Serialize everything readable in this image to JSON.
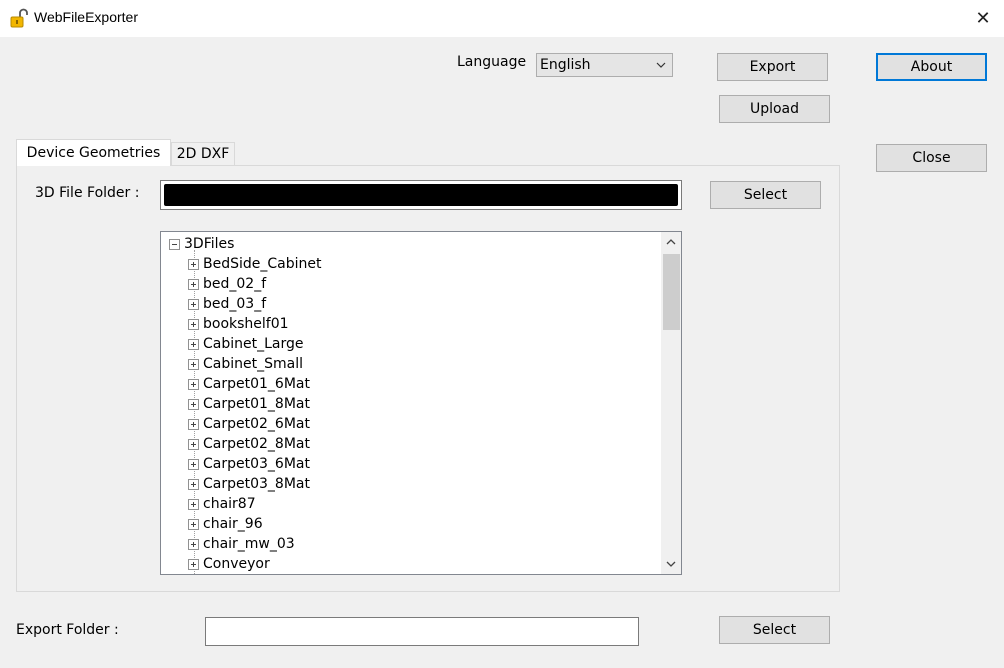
{
  "window": {
    "title": "WebFileExporter",
    "close_glyph": "✕",
    "app_icon": "padlock-icon"
  },
  "toolbar": {
    "language_label": "Language",
    "language_value": "English",
    "export_label": "Export",
    "upload_label": "Upload",
    "about_label": "About",
    "close_label": "Close"
  },
  "tabs": [
    {
      "label": "Device Geometries",
      "active": true
    },
    {
      "label": "2D DXF",
      "active": false
    }
  ],
  "device_geometries": {
    "folder_label": "3D File Folder :",
    "folder_value_redacted": true,
    "select_label": "Select",
    "tree": {
      "root": "3DFiles",
      "items": [
        "BedSide_Cabinet",
        "bed_02_f",
        "bed_03_f",
        "bookshelf01",
        "Cabinet_Large",
        "Cabinet_Small",
        "Carpet01_6Mat",
        "Carpet01_8Mat",
        "Carpet02_6Mat",
        "Carpet02_8Mat",
        "Carpet03_6Mat",
        "Carpet03_8Mat",
        "chair87",
        "chair_96",
        "chair_mw_03",
        "Conveyor"
      ]
    }
  },
  "export": {
    "folder_label": "Export Folder :",
    "folder_value": "",
    "select_label": "Select"
  },
  "colors": {
    "window_bg": "#f0f0f0",
    "button_bg": "#e1e1e1",
    "focus_border": "#0078d7",
    "icon_yellow": "#f2b600"
  }
}
